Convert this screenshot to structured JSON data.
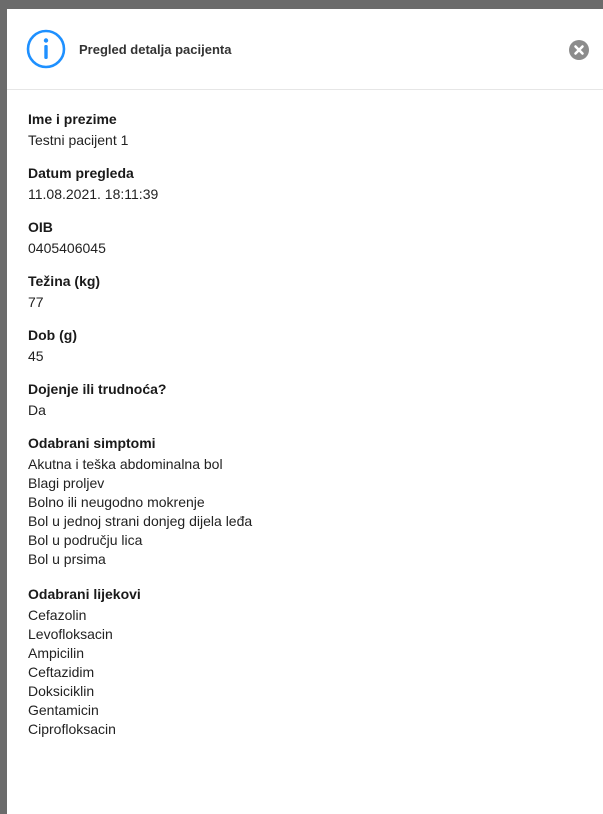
{
  "header": {
    "title": "Pregled detalja pacijenta",
    "accent_color": "#1e90ff",
    "icon": "info-circle-icon",
    "close_icon": "close-icon"
  },
  "fields": {
    "name": {
      "label": "Ime i prezime",
      "value": "Testni pacijent 1"
    },
    "exam_date": {
      "label": "Datum pregleda",
      "value": "11.08.2021. 18:11:39"
    },
    "oib": {
      "label": "OIB",
      "value": "0405406045"
    },
    "weight": {
      "label": "Težina (kg)",
      "value": "77"
    },
    "age": {
      "label": "Dob (g)",
      "value": "45"
    },
    "pregnancy": {
      "label": "Dojenje ili trudnoća?",
      "value": "Da"
    }
  },
  "symptoms": {
    "label": "Odabrani simptomi",
    "items": [
      "Akutna i teška abdominalna bol",
      "Blagi proljev",
      "Bolno ili neugodno mokrenje",
      "Bol u jednoj strani donjeg dijela leđa",
      "Bol u području lica",
      "Bol u prsima"
    ]
  },
  "drugs": {
    "label": "Odabrani lijekovi",
    "items": [
      "Cefazolin",
      "Levofloksacin",
      "Ampicilin",
      "Ceftazidim",
      "Doksiciklin",
      "Gentamicin",
      "Ciprofloksacin"
    ]
  }
}
